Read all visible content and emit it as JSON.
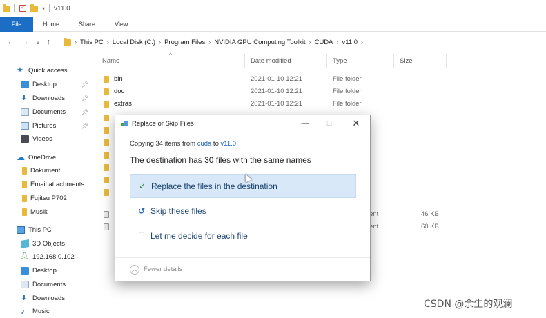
{
  "window": {
    "title": "v11.0"
  },
  "ribbon": {
    "tabs": [
      "File",
      "Home",
      "Share",
      "View"
    ]
  },
  "address": {
    "crumbs": [
      "This PC",
      "Local Disk (C:)",
      "Program Files",
      "NVIDIA GPU Computing Toolkit",
      "CUDA",
      "v11.0"
    ]
  },
  "sidebar": {
    "items": [
      {
        "label": "Quick access",
        "icon": "star-icon"
      },
      {
        "label": "Desktop",
        "icon": "desktop-icon",
        "pinned": true
      },
      {
        "label": "Downloads",
        "icon": "download-icon",
        "pinned": true
      },
      {
        "label": "Documents",
        "icon": "documents-icon",
        "pinned": true
      },
      {
        "label": "Pictures",
        "icon": "pictures-icon",
        "pinned": true
      },
      {
        "label": "Videos",
        "icon": "videos-icon"
      },
      {
        "label": "OneDrive",
        "icon": "cloud-icon"
      },
      {
        "label": "Dokument",
        "icon": "folder-icon"
      },
      {
        "label": "Email attachments",
        "icon": "folder-icon"
      },
      {
        "label": "Fujitsu P702",
        "icon": "folder-icon"
      },
      {
        "label": "Musik",
        "icon": "folder-icon"
      },
      {
        "label": "This PC",
        "icon": "computer-icon"
      },
      {
        "label": "3D Objects",
        "icon": "cube-icon"
      },
      {
        "label": "192.168.0.102",
        "icon": "network-drive-icon"
      },
      {
        "label": "Desktop",
        "icon": "desktop-icon"
      },
      {
        "label": "Documents",
        "icon": "documents-icon"
      },
      {
        "label": "Downloads",
        "icon": "download-icon"
      },
      {
        "label": "Music",
        "icon": "music-icon"
      }
    ]
  },
  "filelist": {
    "columns": [
      "Name",
      "Date modified",
      "Type",
      "Size"
    ],
    "rows": [
      {
        "name": "bin",
        "date": "2021-01-10 12:21",
        "type": "File folder",
        "size": ""
      },
      {
        "name": "doc",
        "date": "2021-01-10 12:21",
        "type": "File folder",
        "size": ""
      },
      {
        "name": "extras",
        "date": "2021-01-10 12:21",
        "type": "File folder",
        "size": ""
      }
    ],
    "partial_types": [
      "ent",
      "ent"
    ],
    "partial_sizes": [
      "46 KB",
      "60 KB"
    ]
  },
  "dialog": {
    "title": "Replace or Skip Files",
    "copy_prefix": "Copying 34 items from ",
    "copy_source": "cuda",
    "copy_mid": " to ",
    "copy_dest": "v11.0",
    "message": "The destination has 30 files with the same names",
    "options": [
      "Replace the files in the destination",
      "Skip these files",
      "Let me decide for each file"
    ],
    "fewer_details": "Fewer details"
  },
  "watermark": "CSDN @余生的观澜"
}
